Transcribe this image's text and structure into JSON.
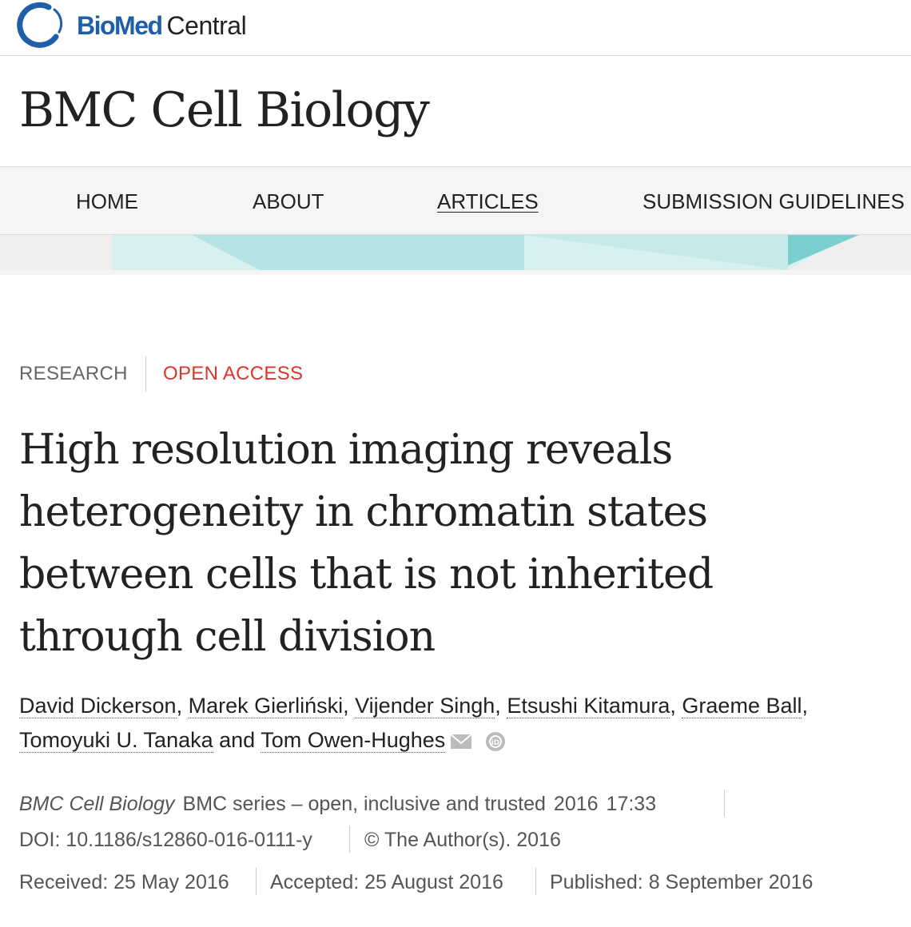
{
  "brand": {
    "name_strong": "BioMed",
    "name_light": "Central"
  },
  "journal": {
    "title": "BMC Cell Biology"
  },
  "nav": {
    "items": [
      {
        "label": "HOME"
      },
      {
        "label": "ABOUT"
      },
      {
        "label": "ARTICLES",
        "active": true
      },
      {
        "label": "SUBMISSION GUIDELINES"
      }
    ]
  },
  "article": {
    "type": "RESEARCH",
    "access": "OPEN ACCESS",
    "title": "High resolution imaging reveals heterogeneity in chromatin states between cells that is not inherited through cell division",
    "authors": [
      {
        "name": "David Dickerson"
      },
      {
        "name": "Marek Gierliński"
      },
      {
        "name": "Vijender Singh"
      },
      {
        "name": "Etsushi Kitamura"
      },
      {
        "name": "Graeme Ball"
      },
      {
        "name": "Tomoyuki U. Tanaka"
      },
      {
        "name": "Tom Owen-Hughes"
      }
    ],
    "author_separator": ", ",
    "author_conjunction": " and ",
    "icons": [
      "mail-icon",
      "orcid-icon"
    ]
  },
  "citation": {
    "journal": "BMC Cell Biology",
    "series": "BMC series – open, inclusive and trusted",
    "year": "2016",
    "article_number": "17:33",
    "doi": "DOI: 10.1186/s12860-016-0111-y",
    "copyright": "© The Author(s). 2016"
  },
  "dates": {
    "received": "Received: 25 May 2016",
    "accepted": "Accepted: 25 August 2016",
    "published": "Published: 8 September 2016"
  },
  "colors": {
    "brand_blue": "#1f5ea8",
    "open_access_red": "#e0342a",
    "teal_light": "#d8f0f0",
    "teal_mid": "#b3e3e3",
    "teal_dark": "#7ccfcf",
    "nav_bg": "#f5f5f5"
  }
}
